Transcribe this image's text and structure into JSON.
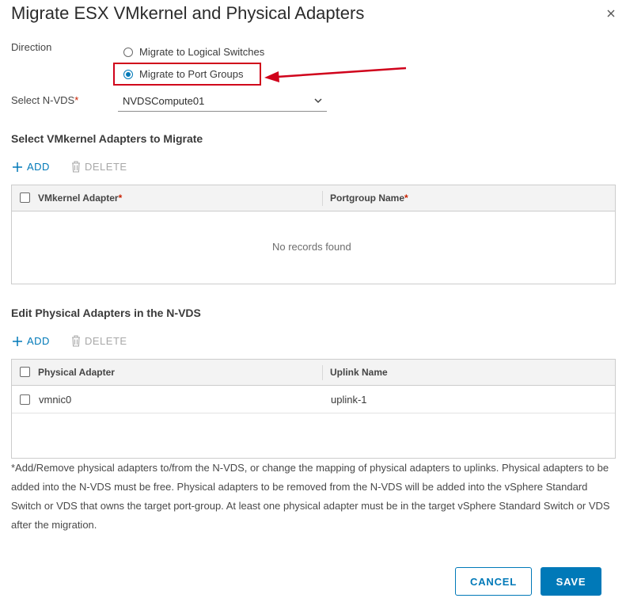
{
  "dialog": {
    "title": "Migrate ESX VMkernel and Physical Adapters",
    "close_icon": "close-icon"
  },
  "direction": {
    "label": "Direction",
    "options": [
      {
        "label": "Migrate to Logical Switches",
        "selected": false
      },
      {
        "label": "Migrate to Port Groups",
        "selected": true
      }
    ]
  },
  "nvds": {
    "label": "Select N-VDS",
    "required_mark": "*",
    "value": "NVDSCompute01"
  },
  "vmkernel_section": {
    "title": "Select VMkernel Adapters to Migrate",
    "add_label": "ADD",
    "delete_label": "DELETE",
    "columns": [
      {
        "label": "VMkernel Adapter",
        "required_mark": "*"
      },
      {
        "label": "Portgroup Name",
        "required_mark": "*"
      }
    ],
    "empty_message": "No records found"
  },
  "physical_section": {
    "title": "Edit Physical Adapters in the N-VDS",
    "add_label": "ADD",
    "delete_label": "DELETE",
    "columns": [
      {
        "label": "Physical Adapter"
      },
      {
        "label": "Uplink Name"
      }
    ],
    "rows": [
      {
        "adapter": "vmnic0",
        "uplink": "uplink-1"
      }
    ]
  },
  "note": "*Add/Remove physical adapters to/from the N-VDS, or change the mapping of physical adapters to uplinks. Physical adapters to be added into the N-VDS must be free. Physical adapters to be removed from the N-VDS will be added into the vSphere Standard Switch or VDS that owns the target port-group. At least one physical adapter must be in the target vSphere Standard Switch or VDS after the migration.",
  "footer": {
    "cancel_label": "CANCEL",
    "save_label": "SAVE"
  },
  "colors": {
    "accent": "#0079b8",
    "annotation": "#d0021b",
    "required": "#c92100"
  }
}
